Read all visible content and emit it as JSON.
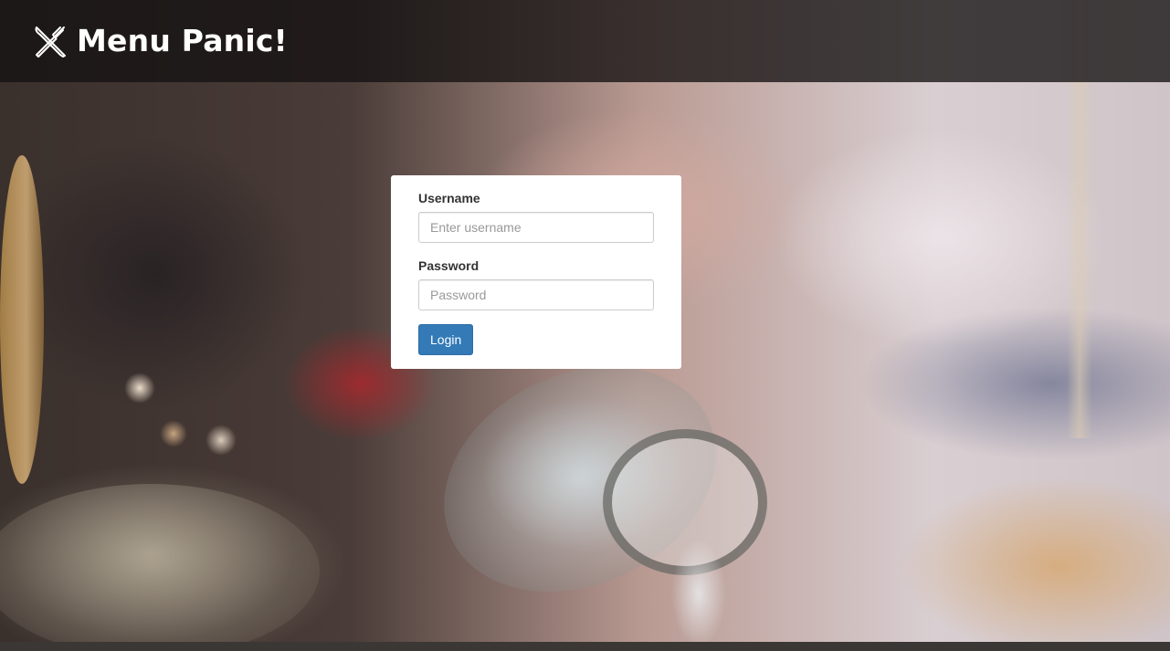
{
  "header": {
    "app_title": "Menu Panic!",
    "logo_icon": "utensils-crossed-icon"
  },
  "login_form": {
    "username_label": "Username",
    "username_placeholder": "Enter username",
    "username_value": "",
    "password_label": "Password",
    "password_placeholder": "Password",
    "password_value": "",
    "login_button_label": "Login"
  },
  "colors": {
    "primary_button": "#337ab7",
    "header_overlay": "#141212",
    "card_background": "#ffffff"
  }
}
